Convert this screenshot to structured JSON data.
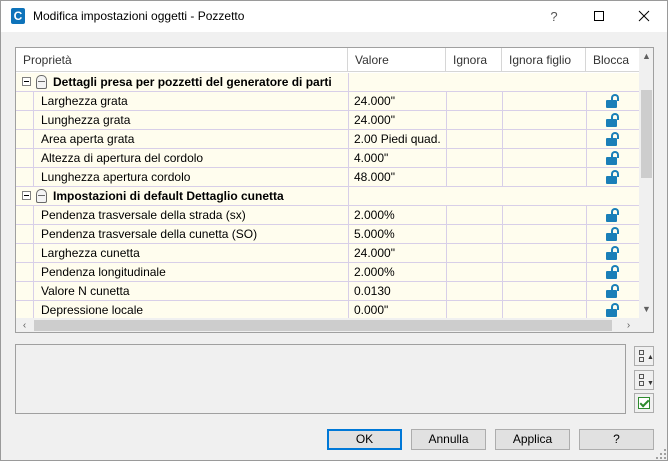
{
  "window": {
    "title": "Modifica impostazioni oggetti - Pozzetto",
    "app_icon_letter": "C",
    "help_label": "?"
  },
  "grid": {
    "columns": [
      "Proprietà",
      "Valore",
      "Ignora",
      "Ignora figlio",
      "Blocca"
    ],
    "rows": [
      {
        "type": "category",
        "label": "Dettagli presa per pozzetti del generatore di parti"
      },
      {
        "type": "property",
        "label": "Larghezza grata",
        "value": "24.000\"",
        "locked": true
      },
      {
        "type": "property",
        "label": "Lunghezza grata",
        "value": "24.000\"",
        "locked": true
      },
      {
        "type": "property",
        "label": "Area aperta grata",
        "value": "2.00 Piedi quad.",
        "locked": true
      },
      {
        "type": "property",
        "label": "Altezza di apertura del cordolo",
        "value": "4.000\"",
        "locked": true
      },
      {
        "type": "property",
        "label": "Lunghezza apertura cordolo",
        "value": "48.000\"",
        "locked": true
      },
      {
        "type": "category",
        "label": "Impostazioni di default Dettaglio cunetta"
      },
      {
        "type": "property",
        "label": "Pendenza trasversale della strada (sx)",
        "value": "2.000%",
        "locked": true
      },
      {
        "type": "property",
        "label": "Pendenza trasversale della cunetta (SO)",
        "value": "5.000%",
        "locked": true
      },
      {
        "type": "property",
        "label": "Larghezza cunetta",
        "value": "24.000\"",
        "locked": true
      },
      {
        "type": "property",
        "label": "Pendenza longitudinale",
        "value": "2.000%",
        "locked": true
      },
      {
        "type": "property",
        "label": "Valore N cunetta",
        "value": "0.0130",
        "locked": true
      },
      {
        "type": "property",
        "label": "Depressione locale",
        "value": "0.000\"",
        "locked": true
      }
    ]
  },
  "buttons": {
    "ok": "OK",
    "cancel": "Annulla",
    "apply": "Applica",
    "help": "?"
  },
  "colors": {
    "row_background": "#fffdee",
    "lock_blue": "#1a7fb8",
    "accent": "#0078d7"
  }
}
